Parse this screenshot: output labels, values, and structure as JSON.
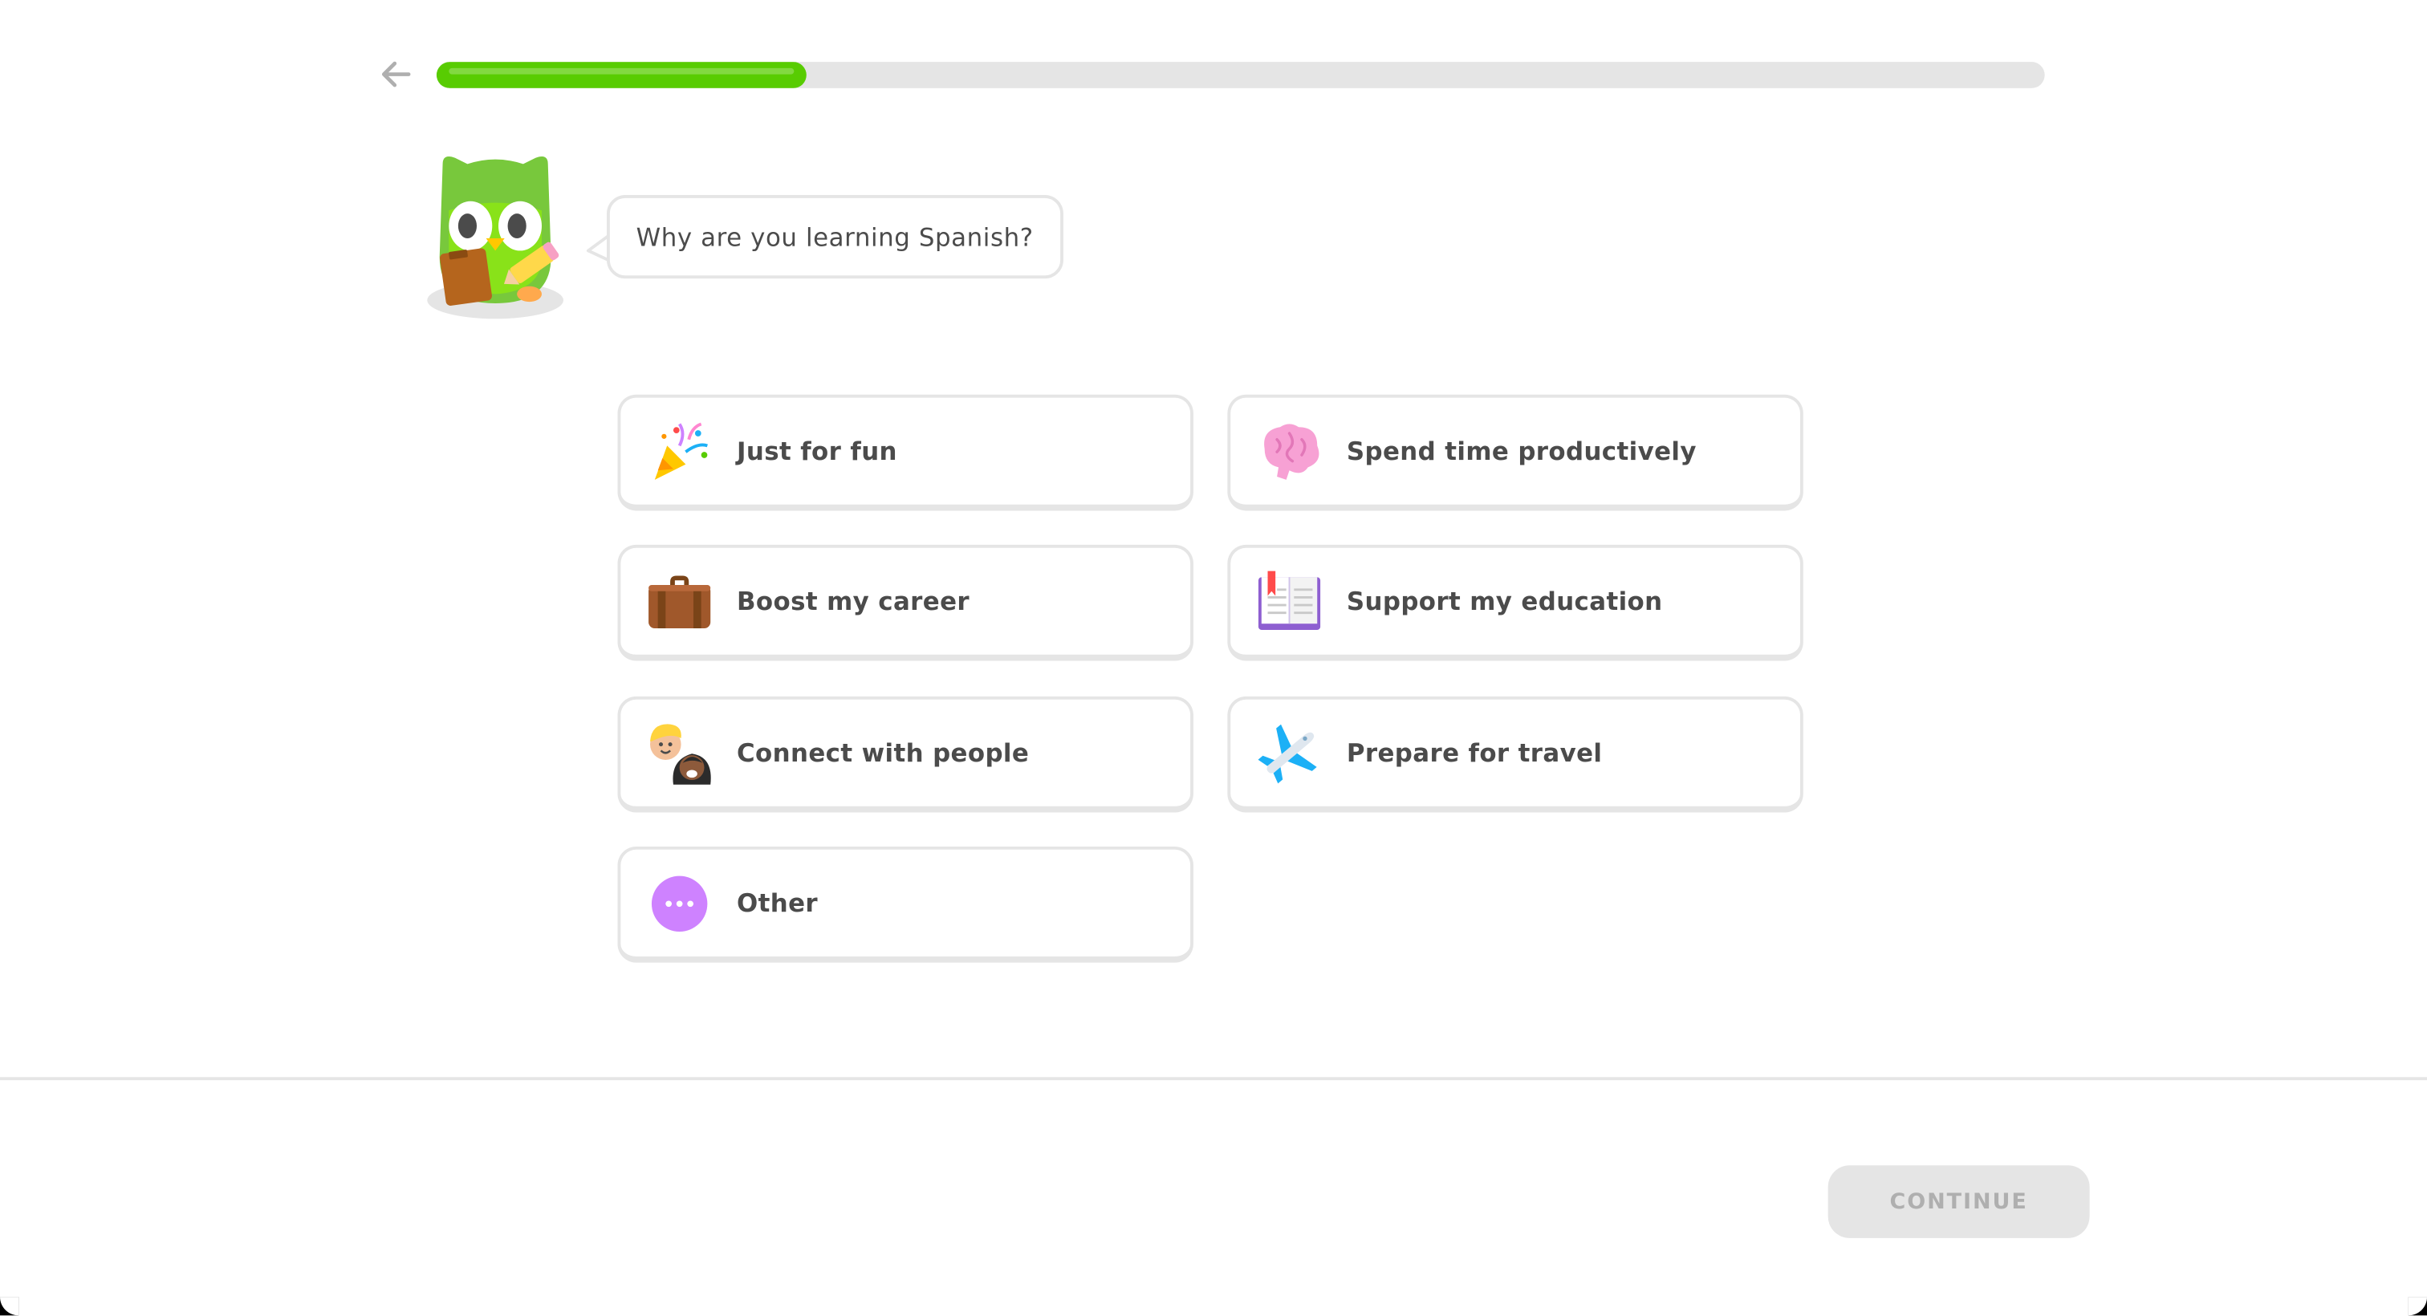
{
  "progress": {
    "fraction": 0.23
  },
  "question": {
    "text": "Why are you learning Spanish?"
  },
  "options": [
    {
      "label": "Just for fun",
      "icon": "party-popper-icon"
    },
    {
      "label": "Spend time productively",
      "icon": "brain-icon"
    },
    {
      "label": "Boost my career",
      "icon": "briefcase-icon"
    },
    {
      "label": "Support my education",
      "icon": "book-icon"
    },
    {
      "label": "Connect with people",
      "icon": "people-icon"
    },
    {
      "label": "Prepare for travel",
      "icon": "airplane-icon"
    },
    {
      "label": "Other",
      "icon": "more-dots-icon"
    }
  ],
  "footer": {
    "continue_label": "CONTINUE"
  },
  "colors": {
    "accent_green": "#58cc02",
    "track": "#e5e5e5",
    "text": "#4b4b4b",
    "disabled_text": "#afafaf"
  }
}
